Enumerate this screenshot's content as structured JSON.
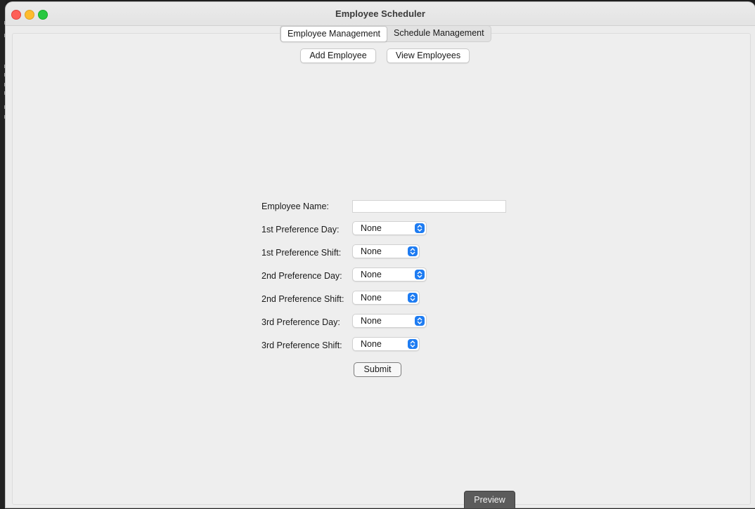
{
  "window": {
    "title": "Employee Scheduler"
  },
  "tabs": [
    {
      "label": "Employee Management",
      "active": true
    },
    {
      "label": "Schedule Management",
      "active": false
    }
  ],
  "toolbar": {
    "add_employee_label": "Add Employee",
    "view_employees_label": "View Employees"
  },
  "form": {
    "employee_name_label": "Employee Name:",
    "employee_name_value": "",
    "fields": [
      {
        "label": "1st Preference Day:",
        "value": "None"
      },
      {
        "label": "1st Preference Shift:",
        "value": "None"
      },
      {
        "label": "2nd Preference Day:",
        "value": "None"
      },
      {
        "label": "2nd Preference Shift:",
        "value": "None"
      },
      {
        "label": "3rd Preference Day:",
        "value": "None"
      },
      {
        "label": "3rd Preference Shift:",
        "value": "None"
      }
    ],
    "submit_label": "Submit"
  },
  "preview_label": "Preview",
  "colors": {
    "close": "#fe5f57",
    "minimize": "#febc2e",
    "maximize": "#28c840",
    "select_accent": "#1e7cf2"
  }
}
